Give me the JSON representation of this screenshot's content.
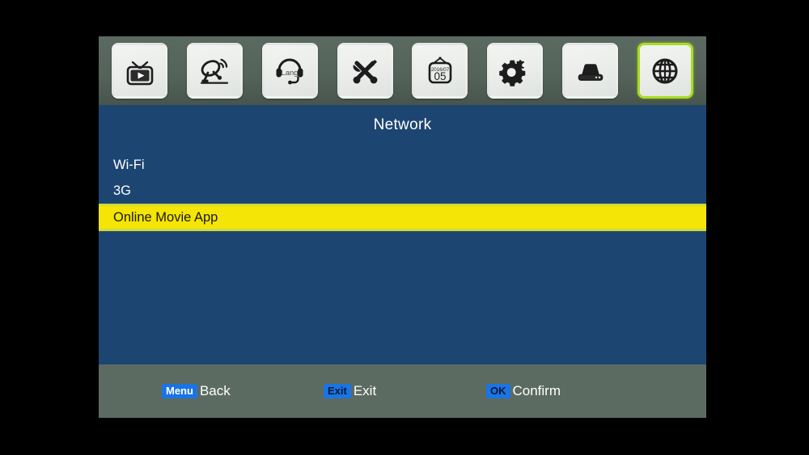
{
  "topbar": {
    "items": [
      {
        "icon": "tv-play-icon",
        "name": "tv-channel"
      },
      {
        "icon": "satellite-dish-icon",
        "name": "installation"
      },
      {
        "icon": "headset-lang-icon",
        "name": "language"
      },
      {
        "icon": "tools-wrench-screwdriver-icon",
        "name": "system-setup"
      },
      {
        "icon": "calendar-icon",
        "name": "timer",
        "calendar_month": "2016/07",
        "calendar_day": "05"
      },
      {
        "icon": "gears-icon",
        "name": "settings"
      },
      {
        "icon": "hard-disk-icon",
        "name": "usb-storage"
      },
      {
        "icon": "globe-icon",
        "name": "network",
        "selected": true
      }
    ],
    "selected_index": 7
  },
  "panel": {
    "title": "Network",
    "items": [
      {
        "label": "Wi-Fi",
        "selected": false
      },
      {
        "label": "3G",
        "selected": false
      },
      {
        "label": "Online Movie App",
        "selected": true
      }
    ]
  },
  "footer": {
    "hints": [
      {
        "key": "Menu",
        "label": "Back"
      },
      {
        "key": "Exit",
        "label": "Exit"
      },
      {
        "key": "OK",
        "label": "Confirm"
      }
    ]
  },
  "colors": {
    "panel_blue": "#1d4571",
    "bar_grey_green": "#5c6b61",
    "highlight_yellow": "#f5e506",
    "highlight_border": "#cddb3c",
    "selection_green": "#a8dc24",
    "key_blue": "#1b74e4",
    "background": "#000000"
  }
}
